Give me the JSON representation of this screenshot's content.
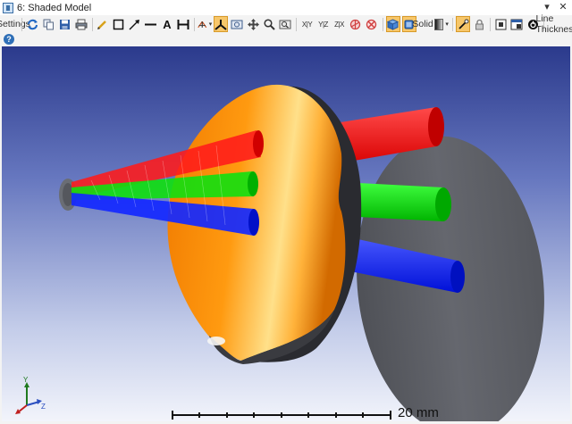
{
  "window": {
    "title": "6: Shaded Model"
  },
  "title_controls": {
    "dropdown": "▾",
    "pin": "✕"
  },
  "toolbar": {
    "settings_label": "Settings",
    "axis_buttons": [
      "X|Y",
      "Y|Z",
      "Z|X"
    ],
    "text_tool": "A",
    "render_mode": "Solid",
    "line_thickness": "Line Thickness"
  },
  "help": {
    "label": "?"
  },
  "scale": {
    "label": "20 mm"
  },
  "triad": {
    "y": "Y",
    "z": "Z"
  },
  "scene": {
    "beam_colors": [
      "#ff1010",
      "#00e000",
      "#1020ff"
    ],
    "lens_color": "#ff8c00",
    "detector_color": "#5d5f66",
    "source_color": "#6a6d74"
  }
}
